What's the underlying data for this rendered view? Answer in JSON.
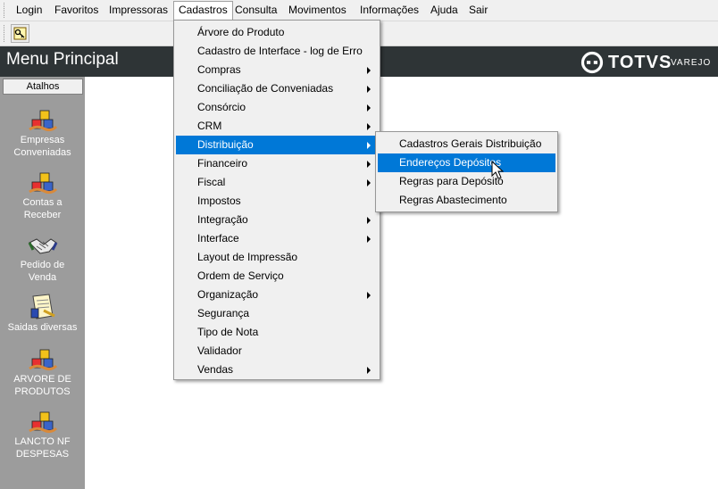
{
  "menubar": {
    "items": [
      "Login",
      "Favoritos",
      "Impressoras",
      "Cadastros",
      "Consulta",
      "Movimentos",
      "Informações",
      "Ajuda",
      "Sair"
    ],
    "active": "Cadastros"
  },
  "header": {
    "title": "Menu Principal",
    "brand_name": "TOTVS",
    "brand_sub": "VAREJO"
  },
  "sidebar": {
    "heading": "Atalhos",
    "shortcuts": [
      {
        "line1": "Empresas",
        "line2": "Conveniadas",
        "icon": "blocks-icon"
      },
      {
        "line1": "Contas a",
        "line2": "Receber",
        "icon": "blocks-icon"
      },
      {
        "line1": "Pedido de",
        "line2": "Venda",
        "icon": "handshake-icon"
      },
      {
        "line1": "Saidas diversas",
        "line2": "",
        "icon": "document-icon"
      },
      {
        "line1": "ARVORE DE",
        "line2": "PRODUTOS",
        "icon": "blocks-icon"
      },
      {
        "line1": "LANCTO NF",
        "line2": "DESPESAS",
        "icon": "blocks-icon"
      }
    ]
  },
  "cadastros_menu": {
    "items": [
      {
        "label": "Árvore do Produto",
        "submenu": false
      },
      {
        "label": "Cadastro de Interface - log de Erro",
        "submenu": false
      },
      {
        "label": "Compras",
        "submenu": true
      },
      {
        "label": "Conciliação de Conveniadas",
        "submenu": true
      },
      {
        "label": "Consórcio",
        "submenu": true
      },
      {
        "label": "CRM",
        "submenu": true
      },
      {
        "label": "Distribuição",
        "submenu": true
      },
      {
        "label": "Financeiro",
        "submenu": true
      },
      {
        "label": "Fiscal",
        "submenu": true
      },
      {
        "label": "Impostos",
        "submenu": false
      },
      {
        "label": "Integração",
        "submenu": true
      },
      {
        "label": "Interface",
        "submenu": true
      },
      {
        "label": "Layout de Impressão",
        "submenu": false
      },
      {
        "label": "Ordem de Serviço",
        "submenu": false
      },
      {
        "label": "Organização",
        "submenu": true
      },
      {
        "label": "Segurança",
        "submenu": false
      },
      {
        "label": "Tipo de Nota",
        "submenu": false
      },
      {
        "label": "Validador",
        "submenu": false
      },
      {
        "label": "Vendas",
        "submenu": true
      }
    ],
    "highlighted": "Distribuição"
  },
  "distribuicao_menu": {
    "items": [
      {
        "label": "Cadastros Gerais Distribuição"
      },
      {
        "label": "Endereços Depósitos"
      },
      {
        "label": "Regras para Depósito"
      },
      {
        "label": "Regras Abastecimento"
      }
    ],
    "highlighted": "Endereços Depósitos"
  },
  "colors": {
    "highlight": "#0078d7",
    "header_bg": "#2e3436",
    "sidebar_bg": "#9c9c9c",
    "menu_bg": "#f0f0f0"
  }
}
